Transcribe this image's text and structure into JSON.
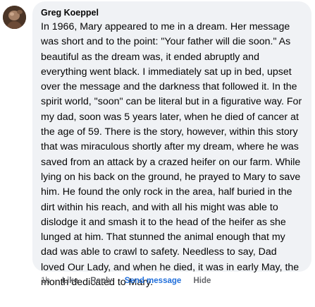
{
  "comment": {
    "author": "Greg Koeppel",
    "text": "In 1966, Mary appeared to me in a dream. Her message was short and to the point: \"Your father will die soon.\" As beautiful as the dream was, it ended abruptly and everything went black. I immediately sat up in bed, upset over the message and the darkness that followed it. In the spirit world, \"soon\" can be literal but in a figurative way. For my dad, soon was 5 years later, when he died of cancer at the age of 59. There is the story, however, within this story that was miraculous shortly after my dream, where he was saved from an attack by a crazed heifer on our farm. While lying on his back on the ground, he prayed to Mary to save him. He found the only rock in the area, half buried in the dirt within his reach, and with all his might was able to dislodge it and smash it to the head of the heifer as she lunged at him. That stunned the animal enough that my dad was able to crawl to safety. Needless to say, Dad loved Our Lady, and when he died, it was in early May, the month dedicated to Mary."
  },
  "actions": {
    "time": "1h",
    "like": "Like",
    "reply": "Reply",
    "send_message": "Send message",
    "hide": "Hide"
  },
  "colors": {
    "bubble": "#f0f2f5",
    "text": "#050505",
    "meta": "#65676b",
    "link": "#216fdb"
  },
  "icons": {
    "avatar": "profile-photo"
  }
}
